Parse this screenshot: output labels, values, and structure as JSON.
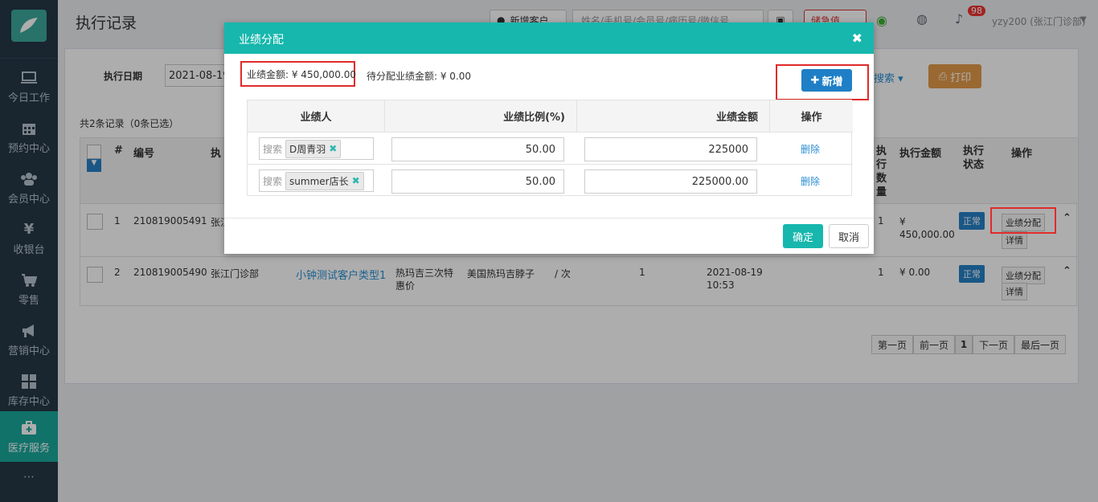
{
  "sidebar": {
    "items": [
      {
        "label": "今日工作",
        "icon": "monitor-icon"
      },
      {
        "label": "预约中心",
        "icon": "calendar-icon"
      },
      {
        "label": "会员中心",
        "icon": "users-icon"
      },
      {
        "label": "收银台",
        "icon": "yen-icon"
      },
      {
        "label": "零售",
        "icon": "cart-icon"
      },
      {
        "label": "营销中心",
        "icon": "megaphone-icon"
      },
      {
        "label": "库存中心",
        "icon": "grid-icon"
      },
      {
        "label": "医疗服务",
        "icon": "medkit-icon",
        "active": true
      }
    ]
  },
  "header": {
    "title": "执行记录",
    "new_customer_label": "新增客户",
    "search_placeholder": "姓名/手机号/会员号/病历号/微信号",
    "urgent_label": "储急值",
    "notification_count": "98",
    "user_label": "yzy200 (张江门诊部)"
  },
  "filter": {
    "date_label": "执行日期",
    "date_value": "2021-08-19",
    "search_link": "搜索",
    "print_label": "打印"
  },
  "records_summary": "共2条记录（0条已选）",
  "table": {
    "headers": {
      "num": "#",
      "code": "编号",
      "exec": "执",
      "qty": "执行数量",
      "amount": "执行金额",
      "status": "执行状态",
      "ops": "操作"
    },
    "rows": [
      {
        "num": "1",
        "code": "210819005491",
        "store": "张江",
        "qty": "1",
        "amount": "¥ 450,000.00",
        "status": "正常",
        "btn1": "业绩分配",
        "btn2": "详情"
      },
      {
        "num": "2",
        "code": "210819005490",
        "store": "张江门诊部",
        "customer_type": "小钟测试客户类型1",
        "project": "热玛吉三次特惠价",
        "product": "美国热玛吉脖子",
        "unit": "/ 次",
        "count": "1",
        "date": "2021-08-19",
        "time": "10:53",
        "qty": "1",
        "amount": "¥ 0.00",
        "status": "正常",
        "btn1": "业绩分配",
        "btn2": "详情"
      }
    ]
  },
  "pager": {
    "first": "第一页",
    "prev": "前一页",
    "current": "1",
    "next": "下一页",
    "last": "最后一页"
  },
  "modal": {
    "title": "业绩分配",
    "total_amount_label": "业绩金额: ¥ 450,000.00",
    "pending_label": "待分配业绩金额: ¥ 0.00",
    "add_label": "新增",
    "headers": {
      "person": "业绩人",
      "ratio": "业绩比例(%)",
      "amount": "业绩金额",
      "ops": "操作"
    },
    "search_placeholder": "搜索",
    "rows": [
      {
        "person": "D周青羽",
        "ratio": "50.00",
        "amount": "225000",
        "delete": "删除"
      },
      {
        "person": "summer店长",
        "ratio": "50.00",
        "amount": "225000.00",
        "delete": "删除"
      }
    ],
    "confirm_label": "确定",
    "cancel_label": "取消"
  },
  "colors": {
    "teal": "#17b7ad",
    "sidebar": "#253746",
    "blue": "#1f7fc6",
    "highlight_red": "#e02b2b"
  }
}
